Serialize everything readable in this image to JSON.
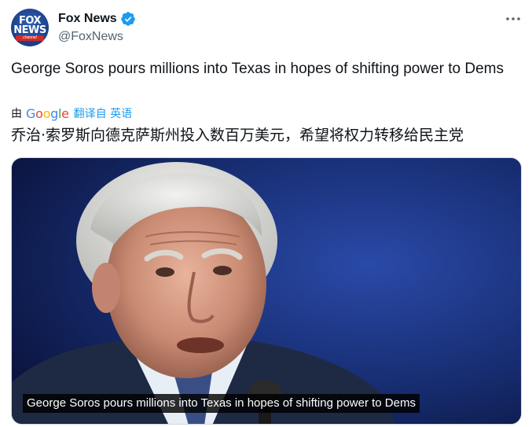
{
  "author": {
    "display_name": "Fox News",
    "handle": "@FoxNews",
    "avatar_logo_line1": "FOX",
    "avatar_logo_line2": "NEWS",
    "avatar_logo_band": "channel",
    "verified": true
  },
  "tweet": {
    "text": "George Soros pours millions into Texas in hopes of shifting power to Dems"
  },
  "translation": {
    "by_label": "由",
    "provider": "Google",
    "link_label": "翻译自 英语",
    "translated_text": "乔治·索罗斯向德克萨斯州投入数百万美元，希望将权力转移给民主党"
  },
  "media": {
    "caption": "George Soros pours millions into Texas in hopes of shifting power to Dems"
  },
  "icons": {
    "verified": "verified-badge-icon",
    "more": "more-options-icon"
  },
  "colors": {
    "link": "#1d9bf0",
    "secondary_text": "#536471",
    "primary_text": "#0f1419",
    "verified": "#1d9bf0"
  }
}
